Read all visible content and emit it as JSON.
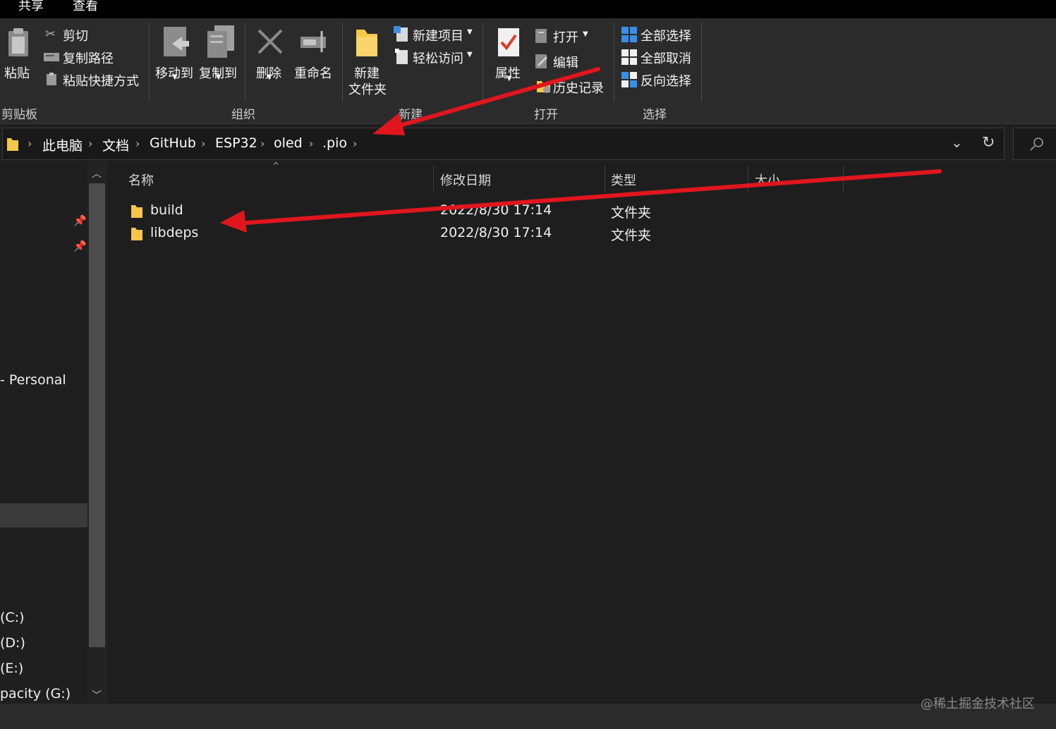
{
  "top_tabs": [
    "共享",
    "查看"
  ],
  "ribbon": {
    "clipboard": {
      "paste": "粘贴",
      "cut": "剪切",
      "copy_path": "复制路径",
      "paste_shortcut": "粘贴快捷方式",
      "group": "剪贴板"
    },
    "organize": {
      "move_to": "移动到",
      "copy_to": "复制到",
      "delete": "删除",
      "rename": "重命名",
      "group": "组织"
    },
    "new": {
      "new_folder_line1": "新建",
      "new_folder_line2": "文件夹",
      "new_item": "新建项目",
      "easy_access": "轻松访问",
      "group": "新建"
    },
    "open": {
      "properties": "属性",
      "open": "打开",
      "edit": "编辑",
      "history": "历史记录",
      "group": "打开"
    },
    "select": {
      "select_all": "全部选择",
      "select_none": "全部取消",
      "invert": "反向选择",
      "group": "选择"
    }
  },
  "breadcrumb": [
    "此电脑",
    "文档",
    "GitHub",
    "ESP32",
    "oled",
    ".pio"
  ],
  "nav": {
    "personal": "- Personal",
    "drives": [
      "(C:)",
      "(D:)",
      "(E:)",
      "pacity (G:)"
    ]
  },
  "columns": {
    "name": "名称",
    "modified": "修改日期",
    "type": "类型",
    "size": "大小"
  },
  "files": [
    {
      "name": "build",
      "modified": "2022/8/30 17:14",
      "type": "文件夹",
      "size": ""
    },
    {
      "name": "libdeps",
      "modified": "2022/8/30 17:14",
      "type": "文件夹",
      "size": ""
    }
  ],
  "watermark": "@稀土掘金技术社区",
  "colors": {
    "background": "#1e1e1e",
    "ribbon": "#2b2b2b",
    "folder": "#f4c64a",
    "annotation_arrow": "#e0161f",
    "select_icon": "#3b8ee8"
  },
  "icons": [
    "paste-icon",
    "scissors-icon",
    "copy-path-icon",
    "paste-shortcut-icon",
    "move-to-icon",
    "copy-to-icon",
    "delete-icon",
    "rename-icon",
    "new-folder-icon",
    "new-item-icon",
    "easy-access-icon",
    "properties-icon",
    "open-icon",
    "edit-icon",
    "history-icon",
    "select-all-icon",
    "select-none-icon",
    "invert-selection-icon",
    "folder-icon",
    "pin-icon",
    "search-icon",
    "refresh-icon",
    "chevron-down-icon"
  ]
}
